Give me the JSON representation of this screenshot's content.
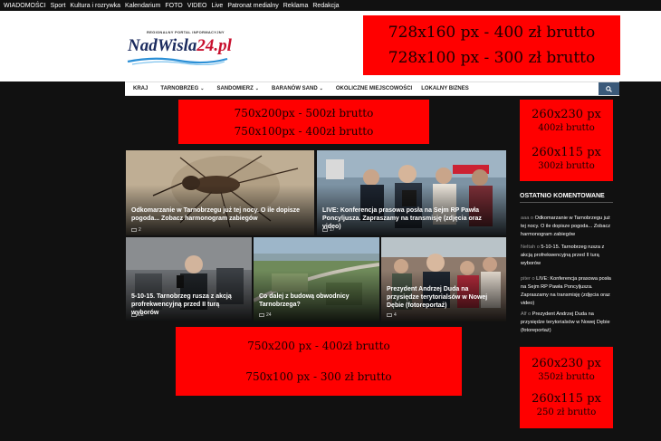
{
  "topbar": {
    "links": [
      "WIADOMOŚCI",
      "Sport",
      "Kultura i rozrywka",
      "Kalendarium",
      "FOTO",
      "VIDEO",
      "Live",
      "Patronat medialny",
      "Reklama",
      "Redakcja"
    ]
  },
  "logo": {
    "tagline": "REGIONALNY PORTAL INFORMACYJNY",
    "name_main": "NadWisla",
    "name_accent": "24.pl"
  },
  "ads": {
    "top": [
      "728x160 px - 400 zł brutto",
      "728x100 px - 300 zł brutto"
    ],
    "mid": [
      "750x200px - 500zł brutto",
      "750x100px - 400zł brutto"
    ],
    "side1": {
      "size_a": "260x230 px",
      "price_a": "400zł brutto",
      "size_b": "260x115 px",
      "price_b": "300zł brutto"
    },
    "bottom": [
      "750x200 px - 400zł brutto",
      "750x100 px - 300 zł brutto"
    ],
    "side2": {
      "size_a": "260x230 px",
      "price_a": "350zł brutto",
      "size_b": "260x115 px",
      "price_b": "250 zł brutto"
    }
  },
  "nav": {
    "items": [
      {
        "label": "KRAJ",
        "dropdown": false
      },
      {
        "label": "TARNOBRZEG",
        "dropdown": true
      },
      {
        "label": "SANDOMIERZ",
        "dropdown": true
      },
      {
        "label": "BARANÓW SAND",
        "dropdown": true
      },
      {
        "label": "OKOLICZNE MIEJSCOWOŚCI",
        "dropdown": false
      },
      {
        "label": "LOKALNY BIZNES",
        "dropdown": false
      }
    ],
    "search_icon": "search-icon"
  },
  "articles": [
    {
      "title": "Odkomarzanie w Tarnobrzegu już tej nocy. O ile dopisze pogoda... Zobacz harmonogram zabiegów",
      "comments": "2"
    },
    {
      "title": "LIVE: Konferencja prasowa posła na Sejm RP Pawła Poncyljusza. Zapraszamy na transmisję (zdjęcia oraz video)",
      "comments": "17"
    },
    {
      "title": "5-10-15. Tarnobrzeg rusza z akcją profrekwencyjną przed II turą wyborów",
      "comments": "28"
    },
    {
      "title": "Co dalej z budową obwodnicy Tarnobrzega?",
      "comments": "24"
    },
    {
      "title": "Prezydent Andrzej Duda na przysiędze terytorialsów w Nowej Dębie (fotoreportaż)",
      "comments": "4"
    }
  ],
  "sidebar": {
    "heading": "OSTATNIO KOMENTOWANE",
    "comments": [
      {
        "author": "aaa",
        "prep": "o",
        "link": "Odkomarzanie w Tarnobrzegu już tej nocy. O ile dopisze pogoda... Zobacz harmonogram zabiegów"
      },
      {
        "author": "Neltah",
        "prep": "o",
        "link": "5-10-15. Tarnobrzeg rusza z akcją profrekwencyjną przed II turą wyborów"
      },
      {
        "author": "piter",
        "prep": "o",
        "link": "LIVE: Konferencja prasowa posła na Sejm RP Pawła Poncyljusza. Zapraszamy na transmisję (zdjęcia oraz video)"
      },
      {
        "author": "Alf",
        "prep": "o",
        "link": "Prezydent Andrzej Duda na przysiędze terytorialsów w Nowej Dębie (fotoreportaż)"
      }
    ]
  },
  "colors": {
    "ad_red": "#ff0000",
    "page_bg": "#111111",
    "nav_search_bg": "#3b5a7a"
  }
}
